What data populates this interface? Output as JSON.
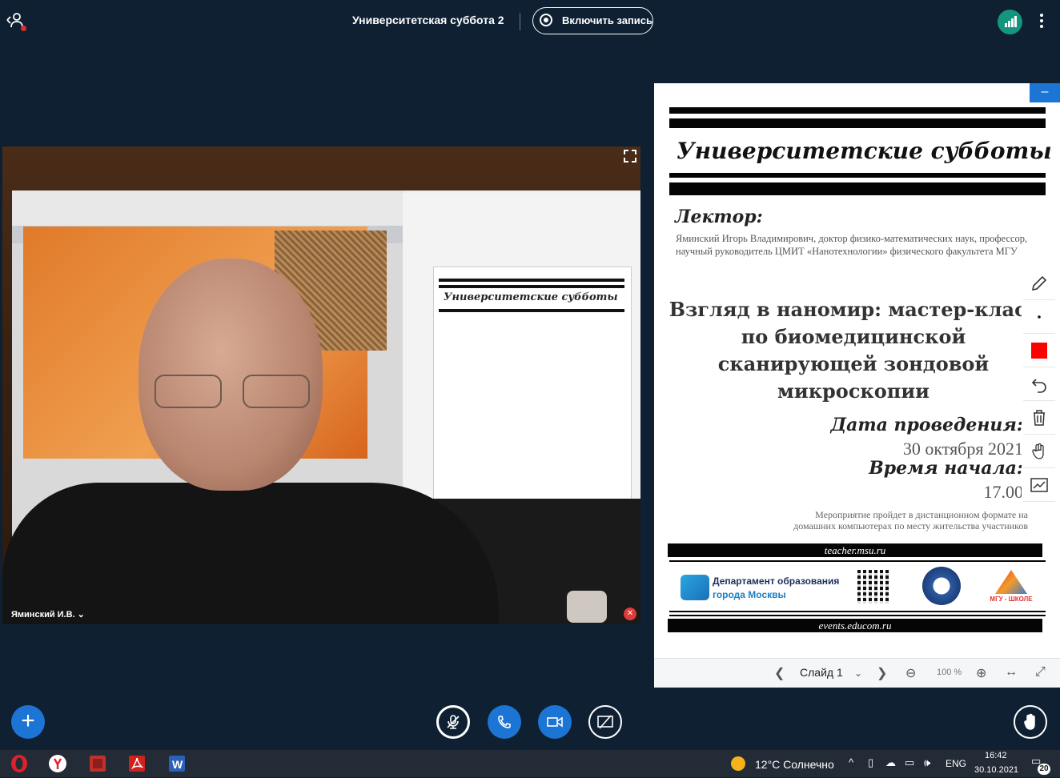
{
  "header": {
    "meeting_title": "Университетская суббота 2",
    "record_button_label": "Включить запись"
  },
  "webcam": {
    "user_name": "Яминский И.В. ⌄",
    "expand_icon": "expand-icon",
    "muted_icon": "mic-off-icon",
    "embedded_doc_title": "Университетские субботы"
  },
  "presentation": {
    "minimize_label": "–",
    "slide": {
      "title": "Университетские субботы",
      "lecturer_label": "Лектор:",
      "lecturer_description": "Яминский Игорь Владимирович, доктор физико-математических наук, профессор, научный руководитель ЦМИТ «Нанотехнологии» физического факультета МГУ",
      "talk_title": "Взгляд в наномир: мастер-класс по биомедицинской сканирующей зондовой микроскопии",
      "date_label": "Дата проведения:",
      "date_value": "30 октября 2021",
      "time_label": "Время начала:",
      "time_value": "17.00",
      "event_note": "Мероприятие пройдет в дистанционном формате на домашних компьютерах по месту жительства участников",
      "link_1": "teacher.msu.ru",
      "link_2": "events.educom.ru",
      "dept_line_1": "Департамент образования",
      "dept_line_2": "города Москвы",
      "school_logo_text": "МГУ - ШКОЛЕ"
    },
    "navigation": {
      "current_slide": "Слайд 1",
      "zoom": "100 %"
    },
    "tools": [
      "pencil-icon",
      "dot-size-icon",
      "color-swatch",
      "undo-icon",
      "trash-icon",
      "hand-icon",
      "whiteboard-icon"
    ],
    "annotation_color": "#ff0000"
  },
  "taskbar": {
    "weather": "12°C  Солнечно",
    "language": "ENG",
    "time": "16:42",
    "date": "30.10.2021",
    "notifications": "20",
    "apps": [
      "opera-icon",
      "yandex-icon",
      "app-icon",
      "acrobat-icon",
      "word-icon"
    ]
  },
  "colors": {
    "background": "#0f2032",
    "accent": "#1c74d4",
    "connection": "#14957d"
  }
}
